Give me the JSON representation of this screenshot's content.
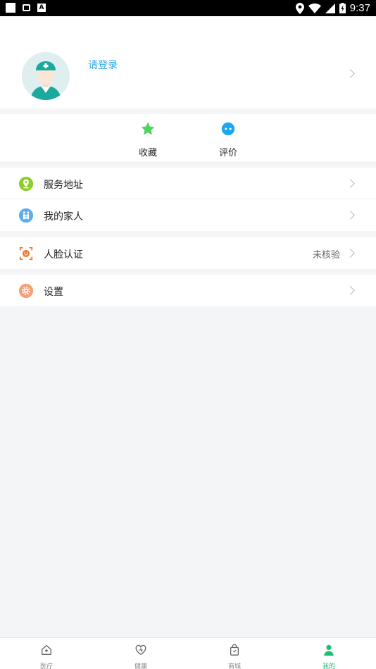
{
  "status_bar": {
    "time": "9:37"
  },
  "profile": {
    "login_text": "请登录"
  },
  "quick_actions": [
    {
      "label": "收藏",
      "icon": "star-icon",
      "color": "#4cd45c"
    },
    {
      "label": "评价",
      "icon": "chat-bubble-icon",
      "color": "#1aa7f0"
    }
  ],
  "menu": {
    "service_address": {
      "label": "服务地址",
      "icon": "location-pin-icon"
    },
    "my_family": {
      "label": "我的家人",
      "icon": "family-icon"
    },
    "face_auth": {
      "label": "人脸认证",
      "value": "未核验",
      "icon": "face-scan-icon"
    },
    "settings": {
      "label": "设置",
      "icon": "gear-icon"
    }
  },
  "tabs": [
    {
      "label": "医疗",
      "icon": "medical-house-icon",
      "active": false
    },
    {
      "label": "健康",
      "icon": "heart-icon",
      "active": false
    },
    {
      "label": "商城",
      "icon": "shopping-bag-icon",
      "active": false
    },
    {
      "label": "我的",
      "icon": "person-icon",
      "active": true
    }
  ],
  "colors": {
    "accent": "#1dbf73",
    "link": "#2aa6e8",
    "background": "#f4f5f7"
  }
}
